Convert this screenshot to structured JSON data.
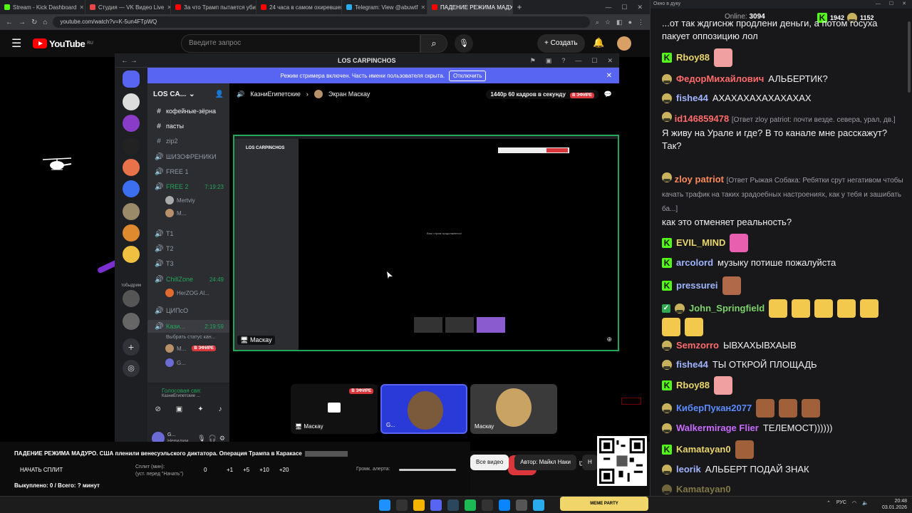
{
  "browser": {
    "tabs": [
      {
        "label": "Stream - Kick Dashboard",
        "color": "#53fc18"
      },
      {
        "label": "Студия — VK Видео Live",
        "color": "#e64646"
      },
      {
        "label": "За что Трамп пытается убить",
        "color": "#ff0000"
      },
      {
        "label": "24 часа в самом охиревшем",
        "color": "#ff0000"
      },
      {
        "label": "Telegram: View @abuwtf",
        "color": "#2aabee"
      },
      {
        "label": "ПАДЕНИЕ РЕЖИМА МАДУ",
        "color": "#ff0000"
      }
    ],
    "url": "youtube.com/watch?v=K-5un4FTpWQ"
  },
  "youtube": {
    "logo": "YouTube",
    "region": "RU",
    "search_placeholder": "Введите запрос",
    "create_label": "+ Создать"
  },
  "discord": {
    "window_title": "LOS CARPINCHOS",
    "banner_text": "Режим стримера включен. Часть имени пользователя скрыта.",
    "banner_button": "Отключить",
    "server_name": "LOS CA...",
    "guild_label": "тобыдрим",
    "channels": [
      {
        "icon": "#",
        "name": "кофейные-зёрна",
        "bright": true
      },
      {
        "icon": "#",
        "name": "пасты",
        "bright": true
      },
      {
        "icon": "#",
        "name": "zip2",
        "bright": false
      },
      {
        "icon": "🔊",
        "name": "ШИЗОФРЕНИКИ",
        "bright": false
      },
      {
        "icon": "🔊",
        "name": "FREE 1",
        "bright": false
      },
      {
        "icon": "🔊",
        "name": "FREE 2",
        "time": "7:19:23",
        "active": true
      },
      {
        "icon": "🔊",
        "name": "T1",
        "bright": false
      },
      {
        "icon": "🔊",
        "name": "T2",
        "bright": false
      },
      {
        "icon": "🔊",
        "name": "T3",
        "bright": false
      },
      {
        "icon": "🔊",
        "name": "ChillZone",
        "time": "24:49",
        "active": true
      },
      {
        "icon": "🔊",
        "name": "ЦИПсО",
        "bright": false
      },
      {
        "icon": "🔊",
        "name": "Кази...",
        "time": "2:19:59",
        "active": true,
        "bright": true
      }
    ],
    "free2_users": [
      "Mertviy",
      "M..."
    ],
    "chill_users": [
      "HerZOG Al..."
    ],
    "kazi_status": "Выбрать статус кан...",
    "kazi_users": [
      "M...",
      "G..."
    ],
    "live_badge": "В ЭФИРЕ",
    "voice_status": "Голосовая свя:",
    "voice_channel": "КазниЕгипетские ...",
    "user_name": "G...",
    "user_status": "Невидим...",
    "stage_channel": "КазниЕгипетские",
    "stage_screen": "Экран Маскау",
    "quality": "1440p 60 кадров в секунду",
    "sharer": "Маскау",
    "inner_server": "LOS CARPINCHOS",
    "inner_message": "Ваш стрим продолжается!",
    "tiles": [
      {
        "label": "Маскау",
        "live": "В ЭФИРЕ"
      },
      {
        "label": "G..."
      },
      {
        "label": "Маскау"
      }
    ]
  },
  "overlay": {
    "title": "ПАДЕНИЕ РЕЖИМА МАДУРО. США пленили венесуэльского диктатора. Операция Трампа в Каракасе",
    "start_split": "НАЧАТЬ СПЛИТ",
    "split_label": "Сплит (мин):",
    "split_hint": "(уст. перед \"Начать\")",
    "split_value": "0",
    "increments": [
      "+1",
      "+5",
      "+10",
      "+20"
    ],
    "alert_label": "Громк. алерта:",
    "status": "Выкуплено: 0 / Всего: ? минут"
  },
  "chips": [
    {
      "label": "Все видео",
      "active": true
    },
    {
      "label": "Автор: Майкл Наки",
      "active": false
    },
    {
      "label": "Н",
      "active": false
    }
  ],
  "chat_window": {
    "title": "Окно в дуку",
    "online_label": "Online:",
    "online_count": "3094",
    "kick_count": "1942",
    "other_count": "1152"
  },
  "chat": [
    {
      "user": "",
      "text": "...от так ждгиснж продлени деньги, а потом госуха пакует оппозицию лол",
      "badge": "",
      "color": "#efeff1"
    },
    {
      "user": "Rboy88",
      "text": "",
      "badge": "kick",
      "color": "#e8d56b"
    },
    {
      "user": "ФедорМихайлович",
      "text": "АЛЬБЕРТИК?",
      "badge": "hat",
      "color": "#ff6b6b"
    },
    {
      "user": "fishe44",
      "text": "АХАХАХАХАХАХАХАХ",
      "badge": "hat",
      "color": "#a0b4ff"
    },
    {
      "user": "id146859478",
      "reply": "[Ответ zloy patriot: почти везде. севера, урал, дв.]",
      "text": "Я живу на Урале и где? В то канале мне расскажут? Так?",
      "badge": "hat",
      "color": "#ff6b6b"
    },
    {
      "user": "zloy patriot",
      "reply": "[Ответ Рыжая Собака: Ребятки срут негативом чтобы качать трафик на таких зрадоебных настроениях, как у тебя и зашибать ба...]",
      "text": "как это отменяет реальность?",
      "badge": "hat",
      "color": "#ff8a5b"
    },
    {
      "user": "EVIL_MIND",
      "text": "",
      "badge": "kick",
      "color": "#e8d56b"
    },
    {
      "user": "arcolord",
      "text": "музыку потише пожалуйста",
      "badge": "kick",
      "color": "#a0b4ff"
    },
    {
      "user": "pressurei",
      "text": "",
      "badge": "kick",
      "color": "#a0b4ff"
    },
    {
      "user": "John_Springfield",
      "text": "",
      "badge": "hat",
      "color": "#7dd36b"
    },
    {
      "user": "Semzorro",
      "text": "ЫВХАХЫВХАЫВ",
      "badge": "hat",
      "color": "#ff6b6b"
    },
    {
      "user": "fishe44",
      "text": "ТЫ ОТКРОЙ ПЛОЩАДЬ",
      "badge": "hat",
      "color": "#a0b4ff"
    },
    {
      "user": "Rboy88",
      "text": "",
      "badge": "kick",
      "color": "#e8d56b"
    },
    {
      "user": "КиберПукан2077",
      "text": "",
      "badge": "hat",
      "color": "#5b8bff"
    },
    {
      "user": "Walkermirage Flier",
      "text": "ТЕЛЕМОСТ))))))",
      "badge": "hat",
      "color": "#c86bff"
    },
    {
      "user": "Kamatayan0",
      "text": "",
      "badge": "kick",
      "color": "#e8d56b"
    },
    {
      "user": "leorik",
      "text": "АЛЬБЕРТ ПОДАЙ ЗНАК",
      "badge": "hat",
      "color": "#a0b4ff"
    },
    {
      "user": "Kamatayan0",
      "text": "",
      "badge": "hat",
      "color": "#e8d56b"
    }
  ],
  "taskbar": {
    "meme_widget": "MEME PARTY",
    "lang": "РУС",
    "time": "20:48",
    "date": "03.01.2026"
  }
}
